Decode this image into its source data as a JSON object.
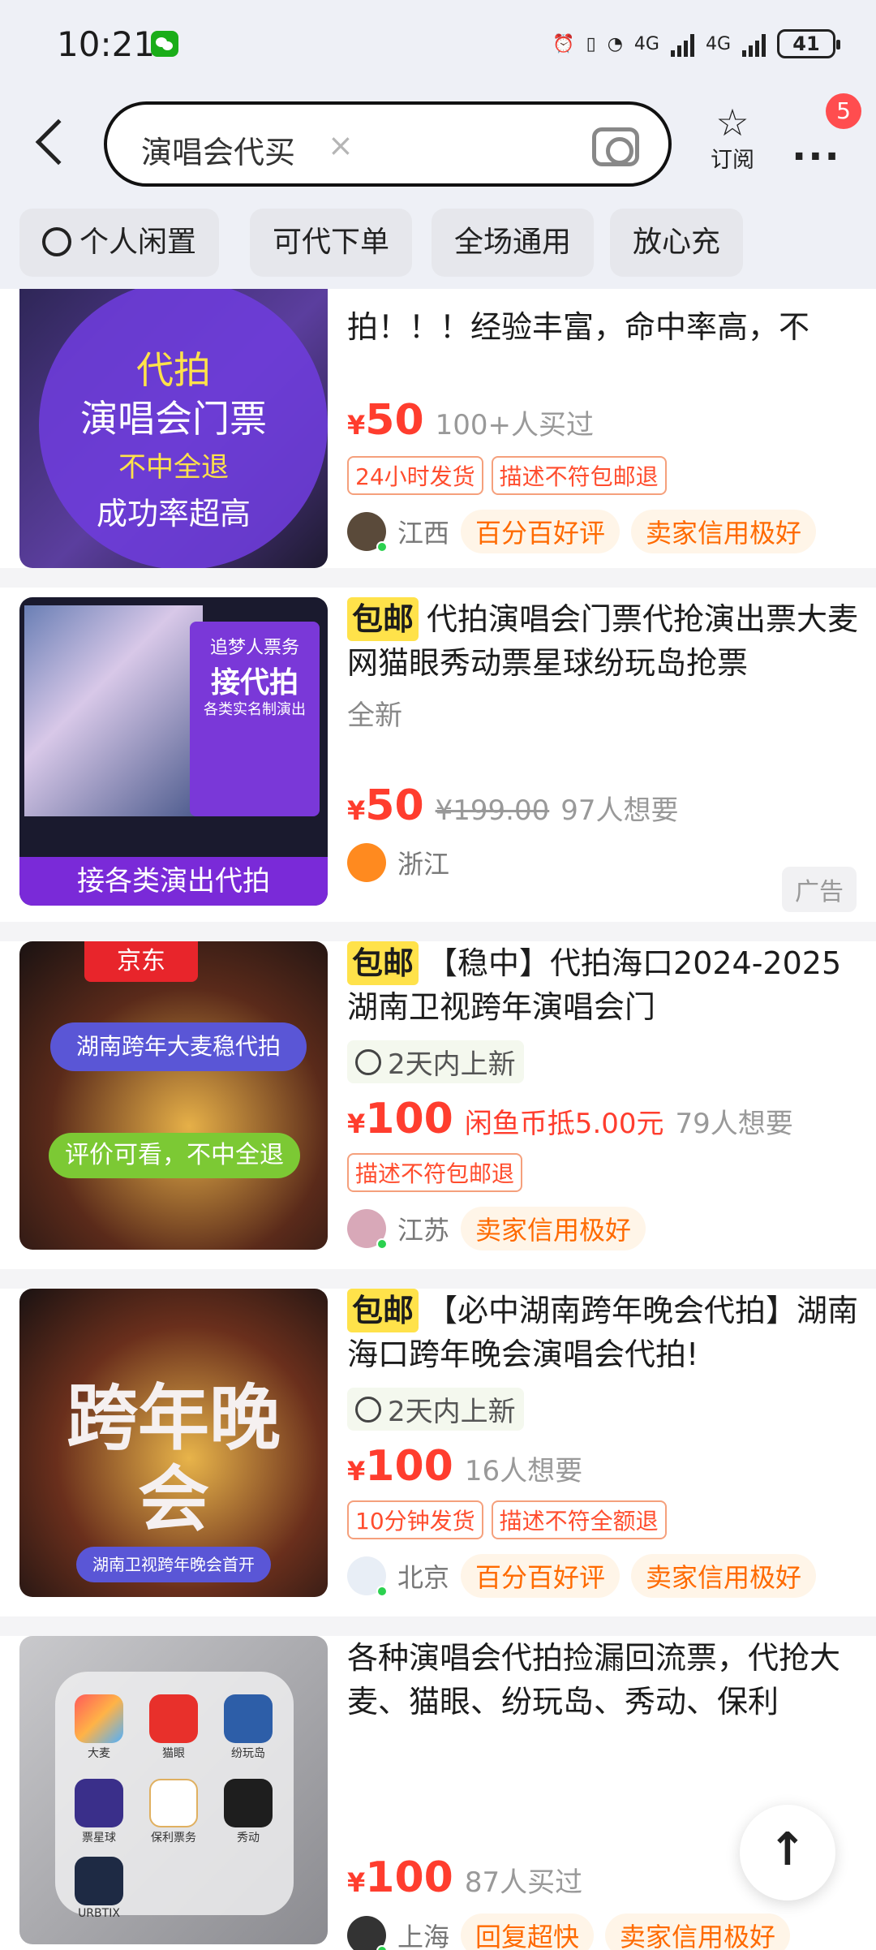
{
  "status": {
    "time": "10:21",
    "net1": "4G",
    "net2": "4G",
    "battery": "41"
  },
  "search": {
    "query": "演唱会代买",
    "clear_glyph": "×"
  },
  "header": {
    "subscribe_label": "订阅",
    "notif_count": "5"
  },
  "chips": [
    "个人闲置",
    "可代下单",
    "全场通用",
    "放心充"
  ],
  "items": [
    {
      "title": "拍！！！经验丰富，命中率高，不",
      "price_symbol": "¥",
      "price": "50",
      "meta": "100+人买过",
      "tags": [
        "24小时发货",
        "描述不符包邮退"
      ],
      "location": "江西",
      "pills": [
        "百分百好评",
        "卖家信用极好"
      ],
      "thumb_text": [
        "代拍",
        "演唱会门票",
        "不中全退",
        "成功率超高"
      ]
    },
    {
      "tag": "包邮",
      "title": "代拍演唱会门票代抢演出票大麦网猫眼秀动票星球纷玩岛抢票",
      "condition": "全新",
      "price_symbol": "¥",
      "price": "50",
      "orig": "¥199.00",
      "meta": "97人想要",
      "location": "浙江",
      "ad": "广告",
      "thumb_text": [
        "追梦人票务",
        "接代拍",
        "各类实名制演出",
        "接各类演出代拍"
      ]
    },
    {
      "tag": "包邮",
      "title": "【稳中】代拍海口2024-2025湖南卫视跨年演唱会门",
      "new_label": "2天内上新",
      "price_symbol": "¥",
      "price": "100",
      "coin": "闲鱼币抵5.00元",
      "meta": "79人想要",
      "tags": [
        "描述不符包邮退"
      ],
      "location": "江苏",
      "pills": [
        "卖家信用极好"
      ],
      "thumb_text": [
        "京东",
        "湖南跨年大麦稳代拍",
        "评价可看，不中全退"
      ]
    },
    {
      "tag": "包邮",
      "title": "【必中湖南跨年晚会代拍】湖南海口跨年晚会演唱会代拍!",
      "new_label": "2天内上新",
      "price_symbol": "¥",
      "price": "100",
      "meta": "16人想要",
      "tags": [
        "10分钟发货",
        "描述不符全额退"
      ],
      "location": "北京",
      "pills": [
        "百分百好评",
        "卖家信用极好"
      ],
      "thumb_text": [
        "跨年晚会",
        "湖南卫视跨年晚会首开"
      ]
    },
    {
      "title": "各种演唱会代拍捡漏回流票，代抢大麦、猫眼、纷玩岛、秀动、保利",
      "price_symbol": "¥",
      "price": "100",
      "meta": "87人买过",
      "location": "上海",
      "pills": [
        "回复超快",
        "卖家信用极好"
      ],
      "thumb_text": [
        "大麦",
        "猫眼",
        "纷玩岛",
        "票星球",
        "保利票务",
        "秀动",
        "URBTIX"
      ]
    }
  ],
  "totop_glyph": "↑"
}
